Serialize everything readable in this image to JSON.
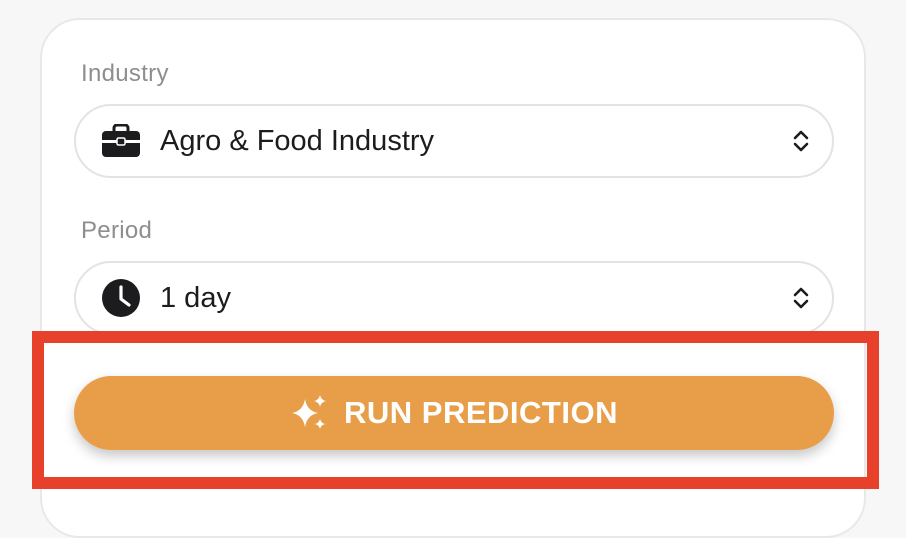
{
  "form": {
    "industry": {
      "label": "Industry",
      "selected": "Agro & Food Industry",
      "icon": "briefcase-icon"
    },
    "period": {
      "label": "Period",
      "selected": "1 day",
      "icon": "clock-icon"
    },
    "run_button": {
      "label": "RUN PREDICTION",
      "icon": "sparkles-icon"
    }
  },
  "colors": {
    "accent_button": "#e89e48",
    "highlight_frame": "#e8412b",
    "label_text": "#8e8e8e",
    "value_text": "#1c1c1e"
  }
}
